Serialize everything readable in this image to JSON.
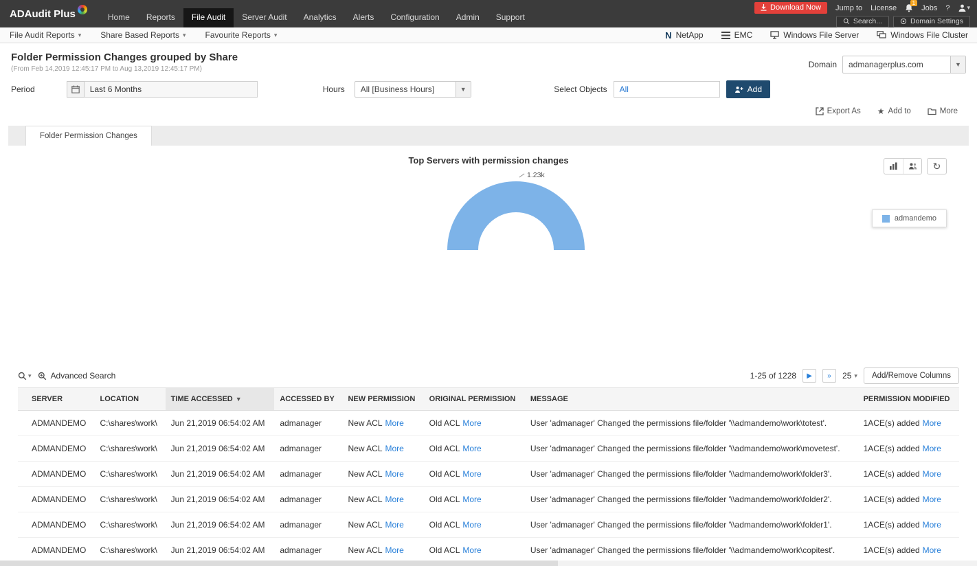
{
  "topnav": {
    "logo": "ADAudit Plus",
    "items": [
      "Home",
      "Reports",
      "File Audit",
      "Server Audit",
      "Analytics",
      "Alerts",
      "Configuration",
      "Admin",
      "Support"
    ],
    "active": "File Audit",
    "download_label": "Download Now",
    "jump_to": "Jump to",
    "license": "License",
    "bell_badge": "1",
    "jobs": "Jobs",
    "help": "?",
    "search_placeholder": "Search...",
    "domain_settings": "Domain Settings"
  },
  "subnav": {
    "left": [
      {
        "label": "File Audit Reports"
      },
      {
        "label": "Share Based Reports"
      },
      {
        "label": "Favourite Reports"
      }
    ],
    "right": [
      {
        "label": "NetApp",
        "icon": "netapp-icon"
      },
      {
        "label": "EMC",
        "icon": "emc-icon"
      },
      {
        "label": "Windows File Server",
        "icon": "windows-file-server-icon"
      },
      {
        "label": "Windows File Cluster",
        "icon": "windows-file-cluster-icon"
      }
    ]
  },
  "page": {
    "title": "Folder Permission Changes grouped by Share",
    "subtitle": "(From Feb 14,2019 12:45:17 PM to Aug 13,2019 12:45:17 PM)",
    "domain_label": "Domain",
    "domain_value": "admanagerplus.com"
  },
  "filters": {
    "period_label": "Period",
    "period_value": "Last 6 Months",
    "hours_label": "Hours",
    "hours_value": "All [Business Hours]",
    "objects_label": "Select Objects",
    "objects_value": "All",
    "add_label": "Add"
  },
  "actions": {
    "export_as": "Export As",
    "add_to": "Add to",
    "more": "More"
  },
  "report_tab": "Folder Permission Changes",
  "chart_data": {
    "type": "pie",
    "variant": "half-donut",
    "title": "Top Servers with permission changes",
    "series": [
      {
        "name": "admandemo",
        "value": 1230,
        "label": "1.23k",
        "color": "#7db3e8"
      }
    ],
    "legend": [
      "admandemo"
    ],
    "legend_position": "right"
  },
  "table": {
    "advanced_search_label": "Advanced Search",
    "pagination": "1-25 of 1228",
    "page_size": "25",
    "columns_button": "Add/Remove Columns",
    "more_label": "More",
    "sorted_column": "TIME ACCESSED",
    "columns": [
      "SERVER",
      "LOCATION",
      "TIME ACCESSED",
      "ACCESSED BY",
      "NEW PERMISSION",
      "ORIGINAL PERMISSION",
      "MESSAGE",
      "PERMISSION MODIFIED"
    ],
    "rows": [
      {
        "server": "ADMANDEMO",
        "location": "C:\\shares\\work\\",
        "time": "Jun 21,2019 06:54:02 AM",
        "accessed_by": "admanager",
        "new_permission": "New ACL",
        "original_permission": "Old ACL",
        "message": "User 'admanager' Changed the permissions file/folder '\\\\admandemo\\work\\totest'.",
        "permission_modified": "1ACE(s) added"
      },
      {
        "server": "ADMANDEMO",
        "location": "C:\\shares\\work\\",
        "time": "Jun 21,2019 06:54:02 AM",
        "accessed_by": "admanager",
        "new_permission": "New ACL",
        "original_permission": "Old ACL",
        "message": "User 'admanager' Changed the permissions file/folder '\\\\admandemo\\work\\movetest'.",
        "permission_modified": "1ACE(s) added"
      },
      {
        "server": "ADMANDEMO",
        "location": "C:\\shares\\work\\",
        "time": "Jun 21,2019 06:54:02 AM",
        "accessed_by": "admanager",
        "new_permission": "New ACL",
        "original_permission": "Old ACL",
        "message": "User 'admanager' Changed the permissions file/folder '\\\\admandemo\\work\\folder3'.",
        "permission_modified": "1ACE(s) added"
      },
      {
        "server": "ADMANDEMO",
        "location": "C:\\shares\\work\\",
        "time": "Jun 21,2019 06:54:02 AM",
        "accessed_by": "admanager",
        "new_permission": "New ACL",
        "original_permission": "Old ACL",
        "message": "User 'admanager' Changed the permissions file/folder '\\\\admandemo\\work\\folder2'.",
        "permission_modified": "1ACE(s) added"
      },
      {
        "server": "ADMANDEMO",
        "location": "C:\\shares\\work\\",
        "time": "Jun 21,2019 06:54:02 AM",
        "accessed_by": "admanager",
        "new_permission": "New ACL",
        "original_permission": "Old ACL",
        "message": "User 'admanager' Changed the permissions file/folder '\\\\admandemo\\work\\folder1'.",
        "permission_modified": "1ACE(s) added"
      },
      {
        "server": "ADMANDEMO",
        "location": "C:\\shares\\work\\",
        "time": "Jun 21,2019 06:54:02 AM",
        "accessed_by": "admanager",
        "new_permission": "New ACL",
        "original_permission": "Old ACL",
        "message": "User 'admanager' Changed the permissions file/folder '\\\\admandemo\\work\\copitest'.",
        "permission_modified": "1ACE(s) added"
      }
    ]
  }
}
